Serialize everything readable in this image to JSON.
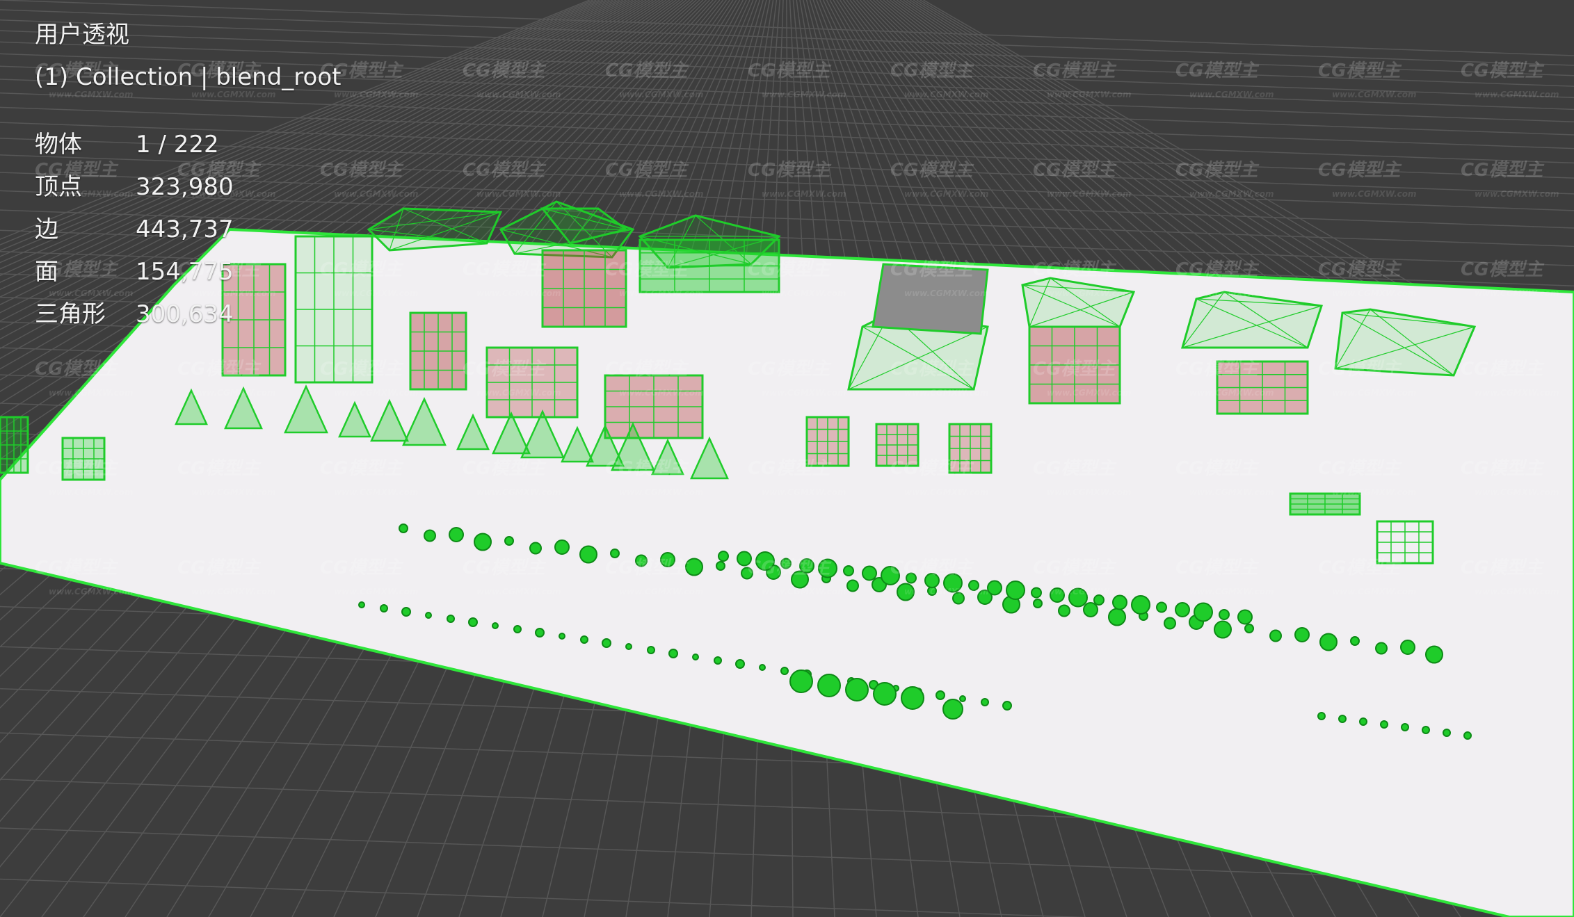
{
  "viewport": {
    "view_name": "用户透视",
    "collection_label": "(1) Collection | blend_root",
    "stats": [
      {
        "label": "物体",
        "value": "1 / 222"
      },
      {
        "label": "顶点",
        "value": "323,980"
      },
      {
        "label": "边",
        "value": "443,737"
      },
      {
        "label": "面",
        "value": "154,775"
      },
      {
        "label": "三角形",
        "value": "300,634"
      }
    ]
  },
  "watermark": {
    "text": "CG模型主",
    "subtext": "www.CGMXW.com"
  },
  "colors": {
    "background": "#3d3d3d",
    "grid_line": "#575757",
    "ground_plane": "#f1eff2",
    "selection_outline": "#2ee53a",
    "wireframe": "#1fcc2a",
    "accent_red": "#b03535",
    "roof_grey": "#8c8c8c"
  }
}
